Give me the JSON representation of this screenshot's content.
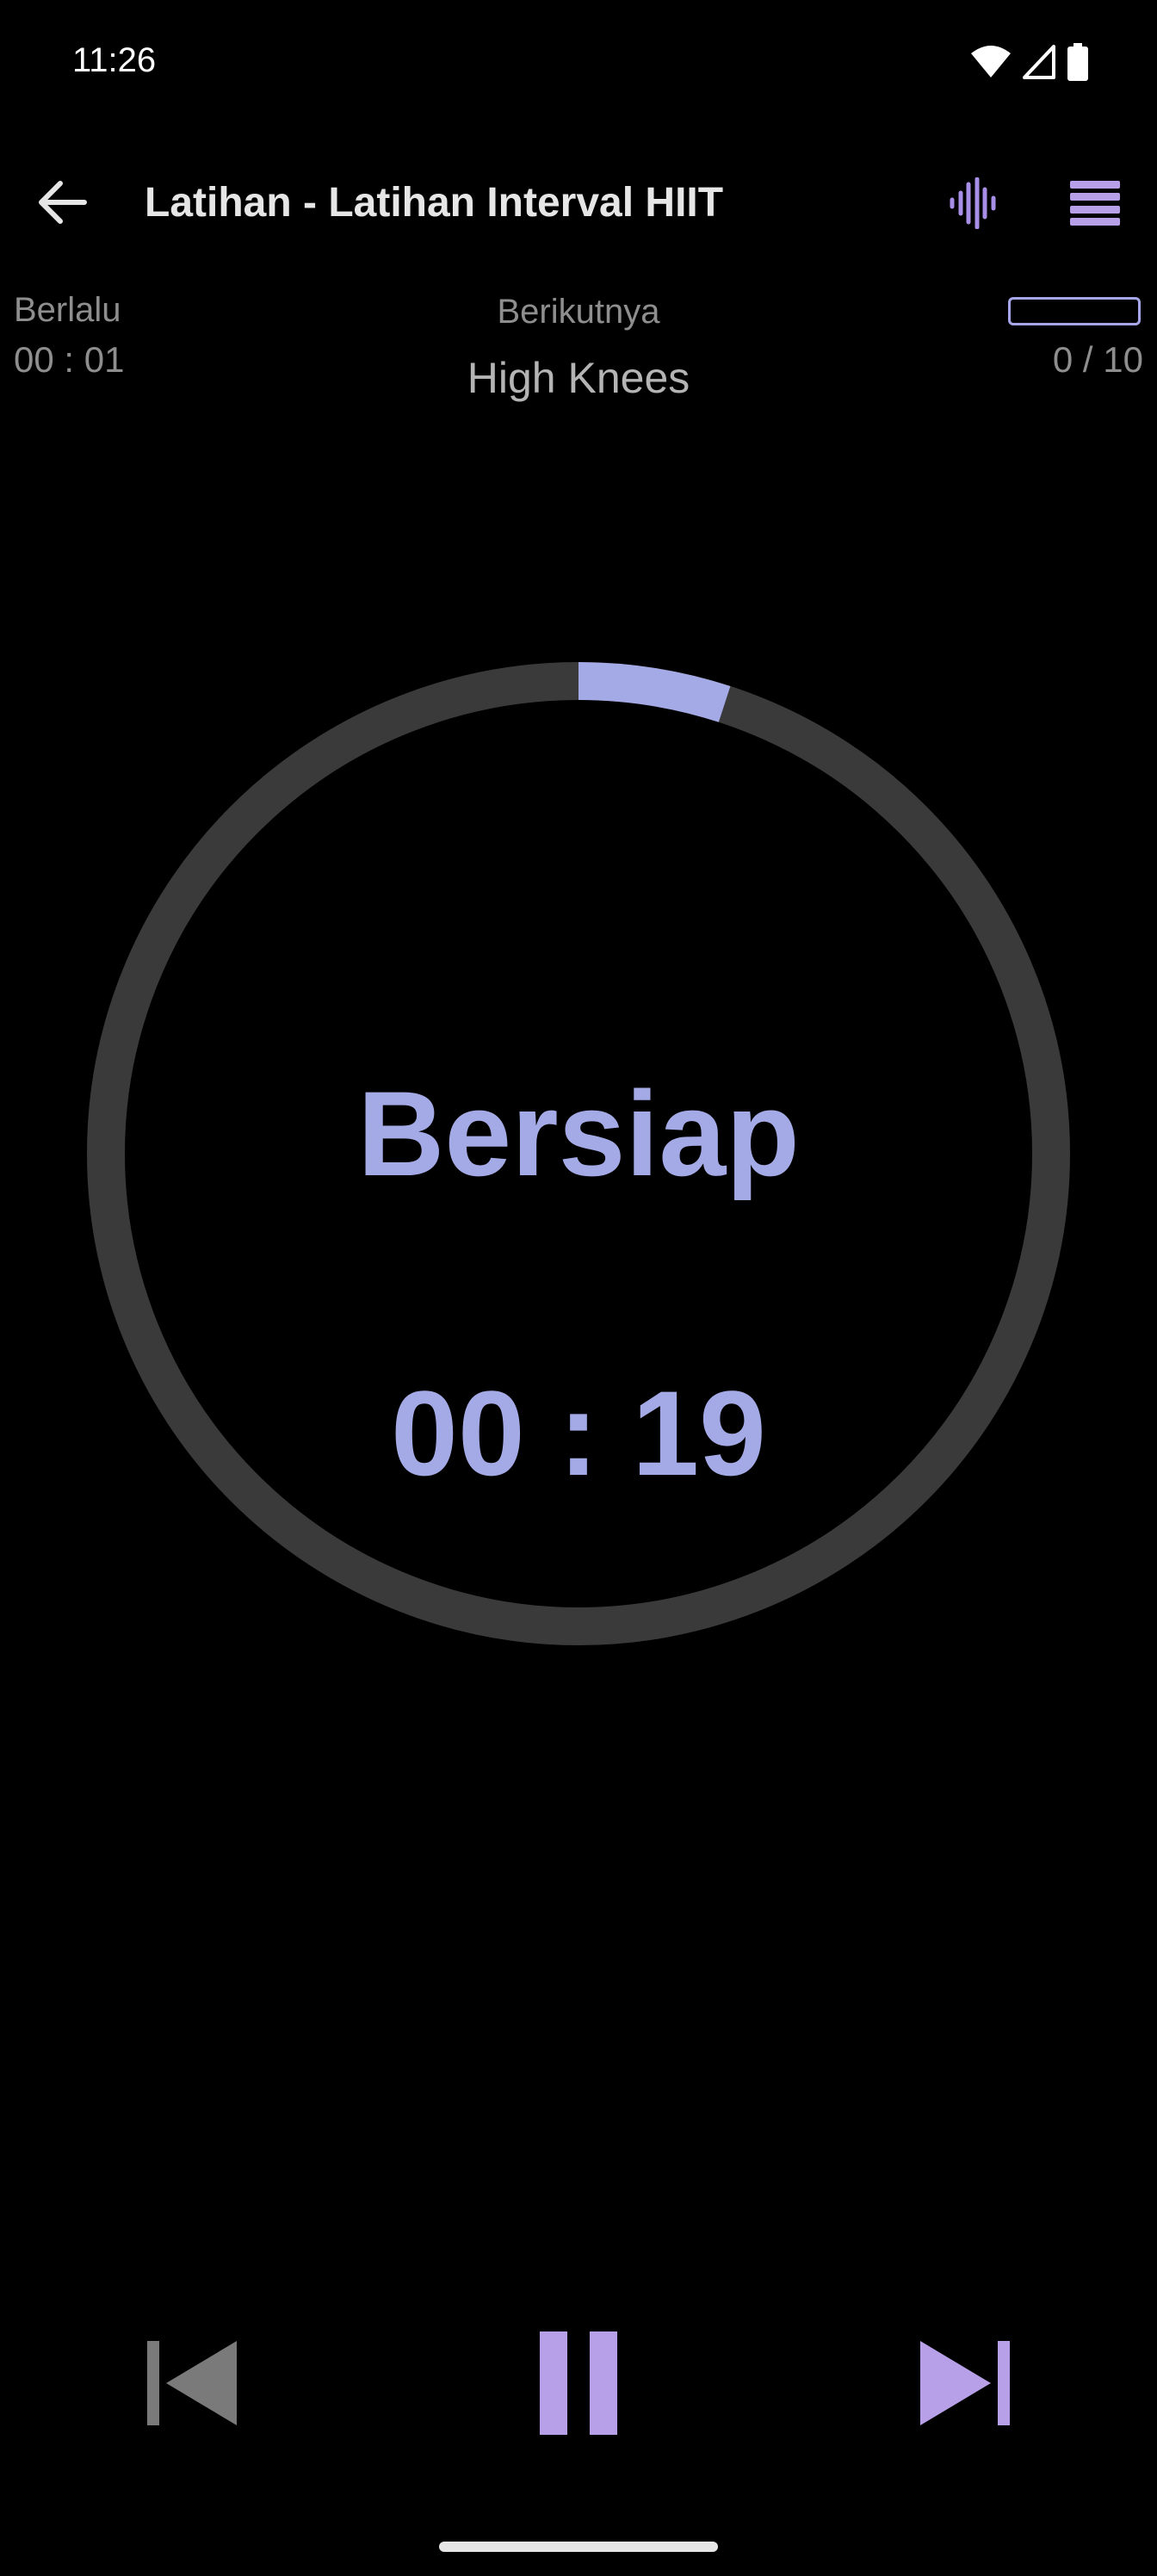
{
  "status_bar": {
    "time": "11:26",
    "icons": [
      "wifi-icon",
      "signal-icon",
      "battery-icon"
    ]
  },
  "app_bar": {
    "title": "Latihan - Latihan Interval HIIT",
    "back_icon": "arrow-back-icon",
    "sound_icon": "waveform-icon",
    "menu_icon": "list-menu-icon"
  },
  "info": {
    "elapsed_label": "Berlalu",
    "elapsed_value": "00 : 01",
    "next_label": "Berikutnya",
    "next_value": "High Knees",
    "round_count": "0 / 10",
    "round_progress": 0
  },
  "timer": {
    "phase": "Bersiap",
    "time": "00 : 19",
    "progress": 0.05
  },
  "controls": {
    "previous_icon": "skip-previous-icon",
    "pause_icon": "pause-icon",
    "next_icon": "skip-next-icon"
  },
  "colors": {
    "accent": "#a4aae6",
    "accent_purple": "#b7a0e8",
    "ring_track": "#3a3a3a",
    "background": "#000000",
    "disabled": "#7a7a7a"
  }
}
